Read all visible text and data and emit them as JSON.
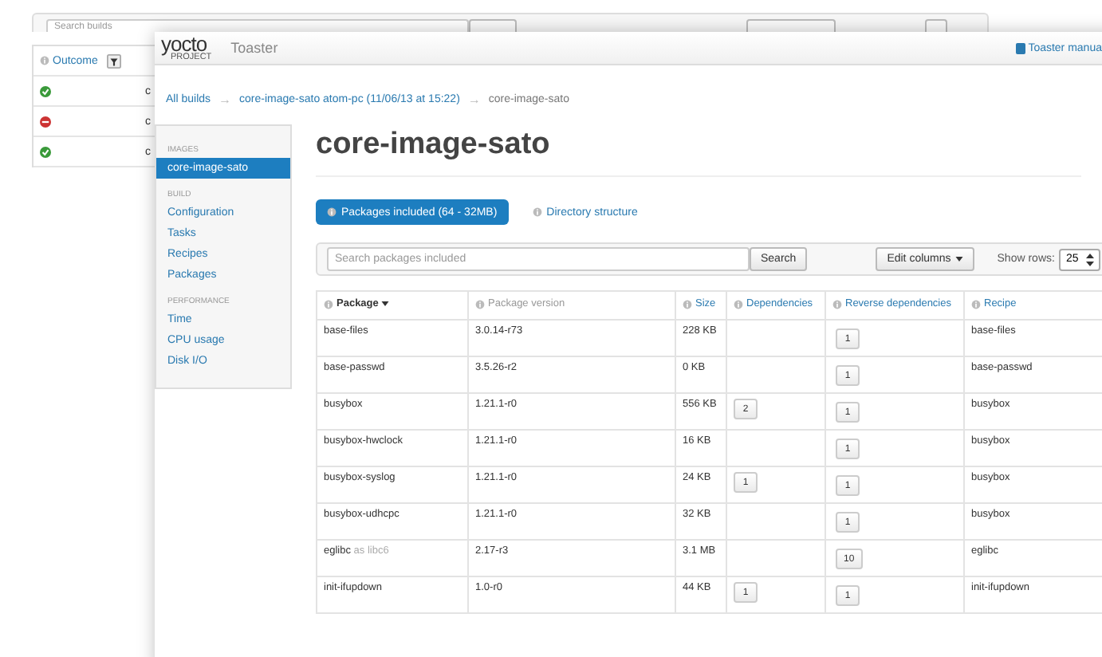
{
  "back_window": {
    "search": {
      "placeholder": "Search builds"
    },
    "table": {
      "columns": [
        "Outcome"
      ],
      "rows": [
        {
          "passed": true,
          "column_2": "c"
        },
        {
          "passed": false,
          "column_2": "c"
        },
        {
          "passed": true,
          "column_2": "c"
        }
      ]
    }
  },
  "window": {
    "logo": "yocto",
    "logo_sub": "PROJECT",
    "title": "Toaster",
    "manual_link": "Toaster manua"
  },
  "breadcrumb": [
    {
      "label": "All builds",
      "link": true
    },
    {
      "arrow": "→",
      "label": "core-image-sato atom-pc (11/06/13 at 15:22)",
      "link": true
    },
    {
      "arrow": "→",
      "label": "core-image-sato",
      "link": false
    }
  ],
  "sidebar": [
    {
      "heading": "IMAGES",
      "items": [
        {
          "label": "core-image-sato",
          "selected": true
        }
      ]
    },
    {
      "heading": "BUILD",
      "items": [
        {
          "label": "Configuration",
          "selected": false
        },
        {
          "label": "Tasks",
          "selected": false
        },
        {
          "label": "Recipes",
          "selected": false
        },
        {
          "label": "Packages",
          "selected": false
        }
      ]
    },
    {
      "heading": "PERFORMANCE",
      "items": [
        {
          "label": "Time",
          "selected": false
        },
        {
          "label": "CPU usage",
          "selected": false
        },
        {
          "label": "Disk I/O",
          "selected": false
        }
      ]
    }
  ],
  "page_title": "core-image-sato",
  "tabs": [
    {
      "label": "Packages included (64 - 32MB)",
      "selected": true
    },
    {
      "label": "Directory structure",
      "selected": false
    }
  ],
  "search": {
    "placeholder": "Search packages included"
  },
  "search_button": "Search",
  "edit_columns": "Edit columns",
  "show_rows_label": "Show rows:",
  "show_rows_value": "25",
  "table": {
    "columns": [
      {
        "label": "Package",
        "kind": "sorted"
      },
      {
        "label": "Package version",
        "kind": "plain"
      },
      {
        "label": "Size",
        "kind": "link"
      },
      {
        "label": "Dependencies",
        "kind": "link"
      },
      {
        "label": "Reverse dependencies",
        "kind": "link"
      },
      {
        "label": "Recipe",
        "kind": "link"
      }
    ],
    "rows": [
      {
        "package": "base-files",
        "version": "3.0.14-r73",
        "size": "228 KB",
        "reverse_dependencies": "1",
        "recipe": "base-files"
      },
      {
        "package": "base-passwd",
        "version": "3.5.26-r2",
        "size": "0 KB",
        "reverse_dependencies": "1",
        "recipe": "base-passwd"
      },
      {
        "package": "busybox",
        "version": "1.21.1-r0",
        "size": "556 KB",
        "dependencies": "2",
        "reverse_dependencies": "1",
        "recipe": "busybox"
      },
      {
        "package": "busybox-hwclock",
        "version": "1.21.1-r0",
        "size": "16 KB",
        "reverse_dependencies": "1",
        "recipe": "busybox"
      },
      {
        "package": "busybox-syslog",
        "version": "1.21.1-r0",
        "size": "24 KB",
        "dependencies": "1",
        "reverse_dependencies": "1",
        "recipe": "busybox"
      },
      {
        "package": "busybox-udhcpc",
        "version": "1.21.1-r0",
        "size": "32 KB",
        "reverse_dependencies": "1",
        "recipe": "busybox"
      },
      {
        "package": "eglibc",
        "package_note": "as libc6",
        "version": "2.17-r3",
        "size": "3.1 MB",
        "reverse_dependencies": "10",
        "recipe": "eglibc"
      },
      {
        "package": "init-ifupdown",
        "version": "1.0-r0",
        "size": "44 KB",
        "dependencies": "1",
        "reverse_dependencies": "1",
        "recipe": "init-ifupdown"
      }
    ]
  }
}
